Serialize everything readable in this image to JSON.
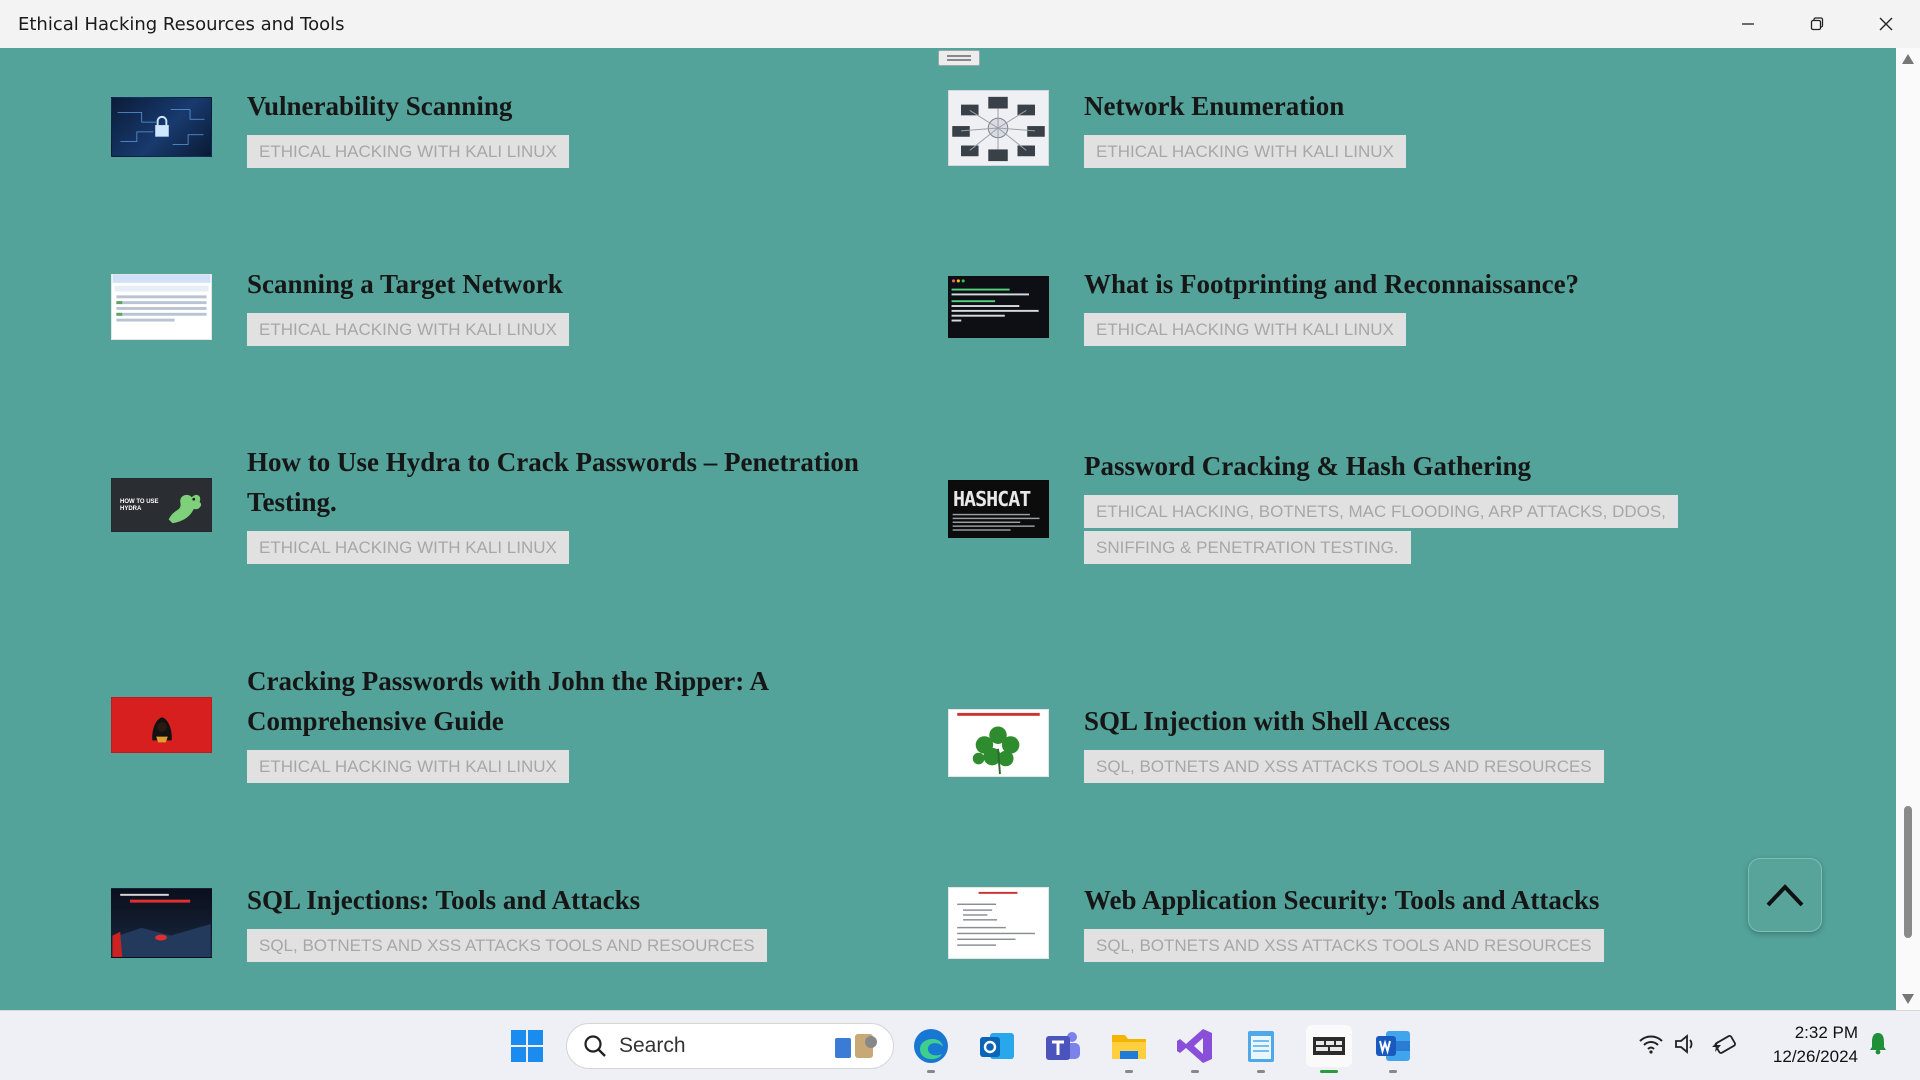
{
  "window": {
    "title": "Ethical Hacking Resources and Tools"
  },
  "articles": [
    {
      "title": "Vulnerability Scanning",
      "tag": "ETHICAL HACKING WITH KALI LINUX"
    },
    {
      "title": "Network Enumeration",
      "tag": "ETHICAL HACKING WITH KALI LINUX"
    },
    {
      "title": "Scanning a Target Network",
      "tag": "ETHICAL HACKING WITH KALI LINUX"
    },
    {
      "title": "What is Footprinting and Reconnaissance?",
      "tag": "ETHICAL HACKING WITH KALI LINUX"
    },
    {
      "title": "How to Use Hydra to Crack Passwords – Penetration Testing.",
      "tag": "ETHICAL HACKING WITH KALI LINUX",
      "thumb_text": "HOW TO USE HYDRA"
    },
    {
      "title": "Password Cracking & Hash Gathering",
      "tag": "ETHICAL HACKING, BOTNETS, MAC FLOODING, ARP ATTACKS, DDOS, SNIFFING & PENETRATION TESTING.",
      "thumb_text": "HASHCAT"
    },
    {
      "title": "Cracking Passwords with John the Ripper: A Comprehensive Guide",
      "tag": "ETHICAL HACKING WITH KALI LINUX"
    },
    {
      "title": "SQL Injection with Shell Access",
      "tag": "SQL, BOTNETS AND XSS ATTACKS TOOLS AND RESOURCES"
    },
    {
      "title": "SQL Injections: Tools and Attacks",
      "tag": "SQL, BOTNETS AND XSS ATTACKS TOOLS AND RESOURCES"
    },
    {
      "title": "Web Application Security: Tools and Attacks",
      "tag": "SQL, BOTNETS AND XSS ATTACKS TOOLS AND RESOURCES"
    }
  ],
  "taskbar": {
    "search_label": "Search",
    "time": "2:32 PM",
    "date": "12/26/2024"
  },
  "colors": {
    "page_bg": "#53a39a",
    "tag_bg": "#e1e1e1",
    "tag_text": "#a7a7a7"
  }
}
